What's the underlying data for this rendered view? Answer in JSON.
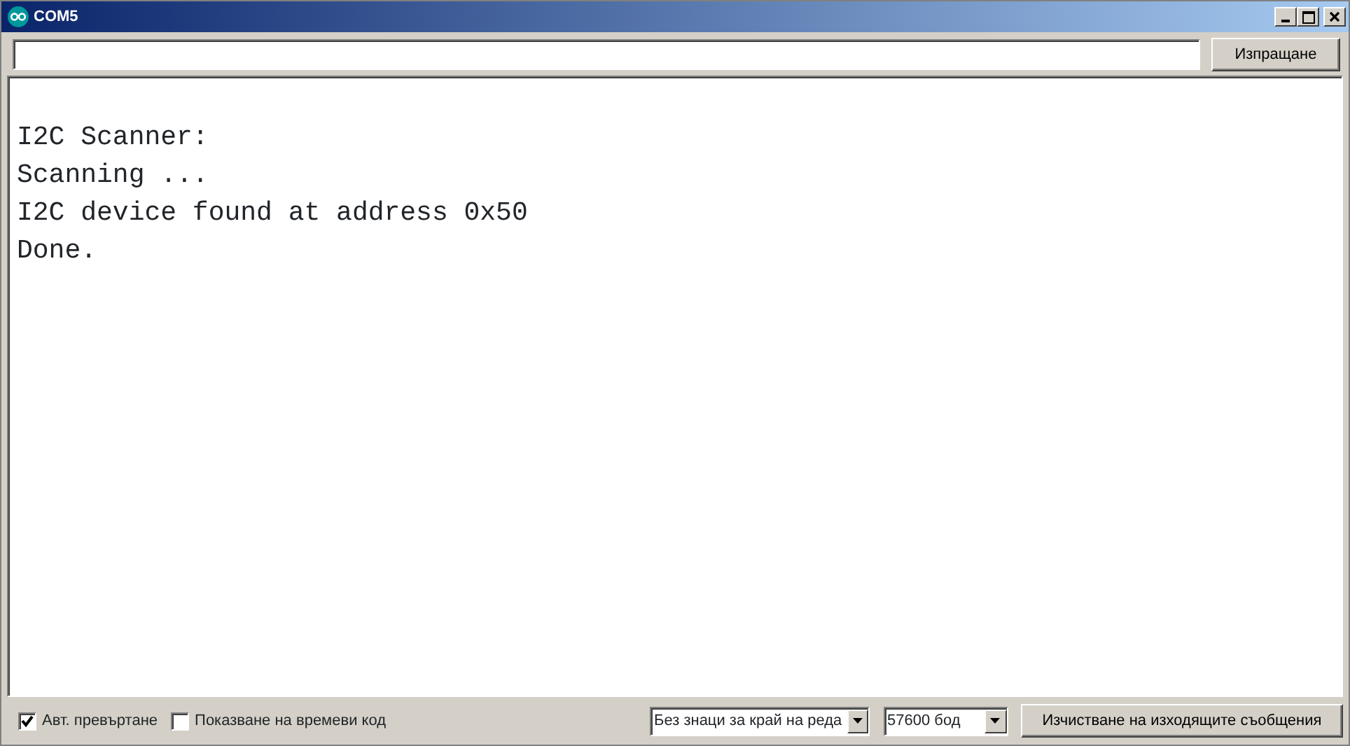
{
  "window": {
    "title": "COM5"
  },
  "send_button": "Изпращане",
  "output_lines": [
    "I2C Scanner:",
    "Scanning ...",
    "I2C device found at address 0x50",
    "Done."
  ],
  "autoscroll": {
    "label": "Авт. превъртане",
    "checked": true
  },
  "timestamp": {
    "label": "Показване на времеви код",
    "checked": false
  },
  "line_ending": {
    "value": "Без знаци за край на реда"
  },
  "baud": {
    "value": "57600 бод"
  },
  "clear_button": "Изчистване на изходящите съобщения"
}
